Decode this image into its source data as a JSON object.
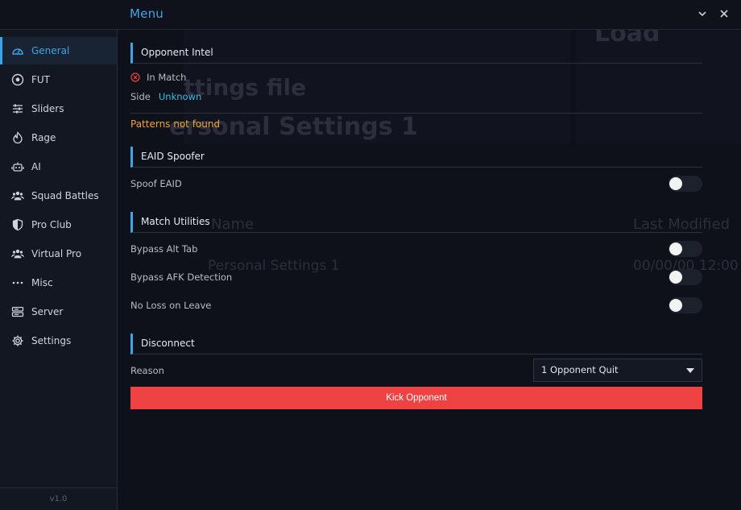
{
  "window": {
    "title": "Menu",
    "minimize_label": "⌄",
    "close_label": "✕"
  },
  "background_ghost": {
    "texts": [
      "ttings file",
      "ersonal Settings 1",
      "Load",
      "Name",
      "Last Modified",
      "Personal Settings 1",
      "00/00/00 12:00"
    ]
  },
  "sidebar": {
    "items": [
      {
        "label": "General",
        "icon": "dashboard-icon",
        "active": true
      },
      {
        "label": "FUT",
        "icon": "football-icon",
        "active": false
      },
      {
        "label": "Sliders",
        "icon": "sliders-icon",
        "active": false
      },
      {
        "label": "Rage",
        "icon": "flame-icon",
        "active": false
      },
      {
        "label": "AI",
        "icon": "robot-icon",
        "active": false
      },
      {
        "label": "Squad Battles",
        "icon": "users-icon",
        "active": false
      },
      {
        "label": "Pro Club",
        "icon": "shield-icon",
        "active": false
      },
      {
        "label": "Virtual Pro",
        "icon": "users-icon",
        "active": false
      },
      {
        "label": "Misc",
        "icon": "more-dots-icon",
        "active": false
      },
      {
        "label": "Server",
        "icon": "server-icon",
        "active": false
      },
      {
        "label": "Settings",
        "icon": "gear-icon",
        "active": false
      }
    ],
    "version": "v1.0"
  },
  "opponent_intel": {
    "title": "Opponent Intel",
    "status_text": "In Match",
    "side_label": "Side",
    "side_value": "Unknown",
    "patterns_text": "Patterns not found"
  },
  "eaid_spoofer": {
    "title": "EAID Spoofer",
    "spoof_label": "Spoof EAID",
    "spoof_enabled": false
  },
  "match_utilities": {
    "title": "Match Utilities",
    "items": [
      {
        "label": "Bypass Alt Tab",
        "enabled": false
      },
      {
        "label": "Bypass AFK Detection",
        "enabled": false
      },
      {
        "label": "No Loss on Leave",
        "enabled": false
      }
    ]
  },
  "disconnect": {
    "title": "Disconnect",
    "reason_label": "Reason",
    "reason_value": "1 Opponent Quit",
    "kick_label": "Kick Opponent"
  },
  "colors": {
    "accent": "#3ea6e8",
    "danger": "#ef4242",
    "warning": "#f0a43a",
    "side_value": "#38c0e8"
  }
}
